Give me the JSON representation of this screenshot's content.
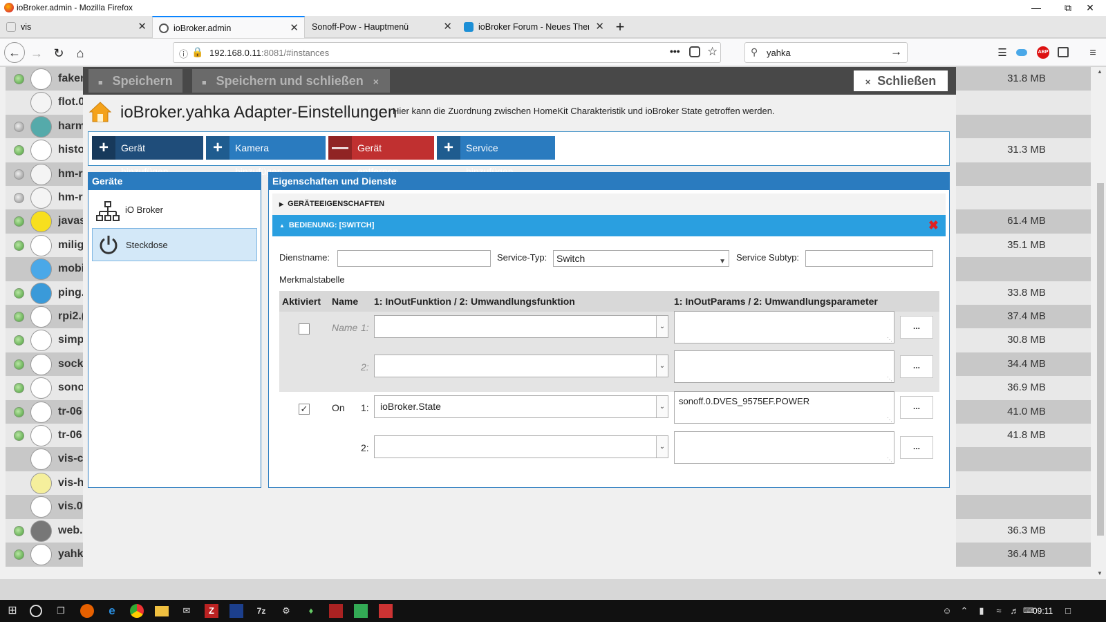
{
  "window": {
    "title": "ioBroker.admin - Mozilla Firefox"
  },
  "tabs": [
    {
      "label": "vis",
      "icon": "vis-tab-icon"
    },
    {
      "label": "ioBroker.admin",
      "icon": "gear-tab-icon"
    },
    {
      "label": "Sonoff-Pow - Hauptmenü",
      "icon": ""
    },
    {
      "label": "ioBroker Forum - Neues Thema",
      "icon": "iobroker-tab-icon"
    }
  ],
  "navbar": {
    "url_host": "192.168.0.11",
    "url_rest": ":8081/#instances",
    "search_value": "yahka"
  },
  "toolbar": {
    "save": "Speichern",
    "save_close": "Speichern und schließen",
    "close": "Schließen"
  },
  "config": {
    "title": "ioBroker.yahka Adapter-Einstellungen",
    "subtitle": "Hier kann die Zuordnung zwischen HomeKit Charakteristik und ioBroker State getroffen werden.",
    "buttons": {
      "add_device": "Gerät hinzufügen",
      "add_camera": "Kamera hinzufügen",
      "remove_device": "Gerät entfernen",
      "add_service": "Service hinzufügen"
    },
    "devices_panel": {
      "title": "Geräte",
      "items": [
        "iO Broker",
        "Steckdose"
      ]
    },
    "props_panel": {
      "title": "Eigenschaften und Dienste",
      "acc_props": "GERÄTEEIGENSCHAFTEN",
      "acc_service": "BEDIENUNG: [SWITCH]"
    },
    "service": {
      "name_label": "Dienstname:",
      "name_value": "",
      "type_label": "Service-Typ:",
      "type_value": "Switch",
      "subtype_label": "Service Subtyp:",
      "subtype_value": "",
      "table_label": "Merkmalstabelle"
    },
    "table": {
      "headers": [
        "Aktiviert",
        "Name",
        "1: InOutFunktion / 2: Umwandlungsfunktion",
        "1: InOutParams / 2: Umwandlungsparameter"
      ],
      "rows": [
        {
          "name": "Name",
          "num1": "1:",
          "func1": "",
          "param1": "",
          "num2": "2:",
          "func2": "",
          "param2": "",
          "checked": false
        },
        {
          "name": "On",
          "num1": "1:",
          "func1": "ioBroker.State",
          "param1": "sonoff.0.DVES_9575EF.POWER",
          "num2": "2:",
          "func2": "",
          "param2": "",
          "checked": true
        }
      ],
      "dots": "..."
    }
  },
  "instances": [
    {
      "name": "faker",
      "mem": "31.8 MB",
      "led": "on",
      "icon": "FAKE"
    },
    {
      "name": "flot.0",
      "mem": "",
      "led": "none",
      "icon": "Flot"
    },
    {
      "name": "harm",
      "mem": "",
      "led": "off",
      "icon": "Harmony"
    },
    {
      "name": "histo",
      "mem": "31.3 MB",
      "led": "on",
      "icon": "clock"
    },
    {
      "name": "hm-r",
      "mem": "",
      "led": "off",
      "icon": "hm"
    },
    {
      "name": "hm-r",
      "mem": "",
      "led": "off",
      "icon": "hm"
    },
    {
      "name": "javas",
      "mem": "61.4 MB",
      "led": "on",
      "icon": "JS"
    },
    {
      "name": "milig",
      "mem": "35.1 MB",
      "led": "on",
      "icon": "mi"
    },
    {
      "name": "mobi",
      "mem": "",
      "led": "none",
      "icon": "mob"
    },
    {
      "name": "ping.",
      "mem": "33.8 MB",
      "led": "on",
      "icon": "P"
    },
    {
      "name": "rpi2.(",
      "mem": "37.4 MB",
      "led": "on",
      "icon": "rpi"
    },
    {
      "name": "simp",
      "mem": "30.8 MB",
      "led": "on",
      "icon": "plug"
    },
    {
      "name": "sock",
      "mem": "34.4 MB",
      "led": "on",
      "icon": "plug"
    },
    {
      "name": "sono",
      "mem": "36.9 MB",
      "led": "on",
      "icon": "Sonoff"
    },
    {
      "name": "tr-06",
      "mem": "41.0 MB",
      "led": "on",
      "icon": "AVM"
    },
    {
      "name": "tr-06",
      "mem": "41.8 MB",
      "led": "on",
      "icon": "AVM"
    },
    {
      "name": "vis-c",
      "mem": "",
      "led": "none",
      "icon": "color"
    },
    {
      "name": "vis-h",
      "mem": "",
      "led": "none",
      "icon": "bulb"
    },
    {
      "name": "vis.0",
      "mem": "",
      "led": "none",
      "icon": "vis"
    },
    {
      "name": "web.",
      "mem": "36.3 MB",
      "led": "on",
      "icon": "www"
    },
    {
      "name": "yahk",
      "mem": "36.4 MB",
      "led": "on",
      "icon": "home"
    }
  ],
  "taskbar": {
    "time": "09:11"
  }
}
